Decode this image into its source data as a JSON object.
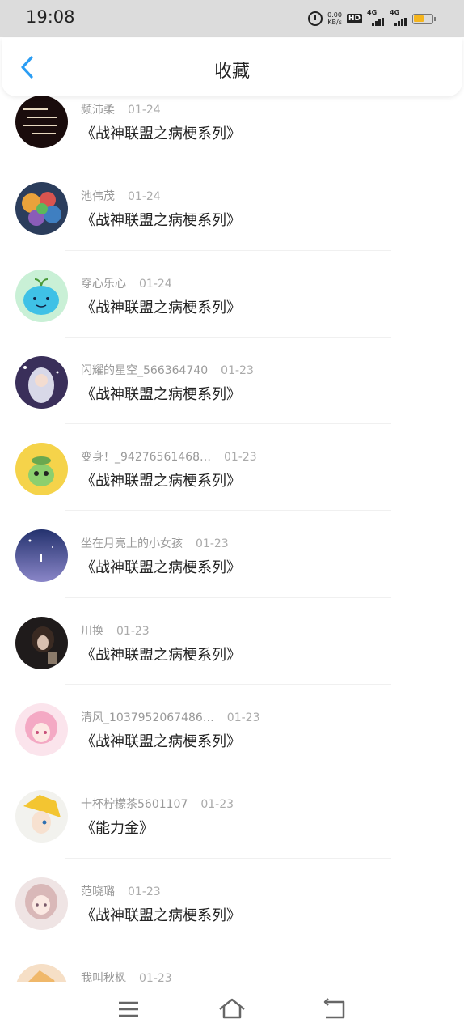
{
  "status_bar": {
    "time": "19:08",
    "net_speed_value": "0.00",
    "net_speed_unit": "KB/s",
    "hd_label": "HD",
    "signal1": "4G",
    "signal2": "4G"
  },
  "header": {
    "title": "收藏",
    "back_icon": "chevron-left-icon"
  },
  "items": [
    {
      "user": "频沛柔",
      "date": "01-24",
      "title": "《战神联盟之病梗系列》"
    },
    {
      "user": "池伟茂",
      "date": "01-24",
      "title": "《战神联盟之病梗系列》"
    },
    {
      "user": "穿心乐心",
      "date": "01-24",
      "title": "《战神联盟之病梗系列》"
    },
    {
      "user": "闪耀的星空_566364740",
      "date": "01-23",
      "title": "《战神联盟之病梗系列》"
    },
    {
      "user": "变身！_94276561468…",
      "date": "01-23",
      "title": "《战神联盟之病梗系列》"
    },
    {
      "user": "坐在月亮上的小女孩",
      "date": "01-23",
      "title": "《战神联盟之病梗系列》"
    },
    {
      "user": "川换",
      "date": "01-23",
      "title": "《战神联盟之病梗系列》"
    },
    {
      "user": "清风_1037952067486…",
      "date": "01-23",
      "title": "《战神联盟之病梗系列》"
    },
    {
      "user": "十杯柠檬茶5601107",
      "date": "01-23",
      "title": "《能力金》"
    },
    {
      "user": "范晓璐",
      "date": "01-23",
      "title": "《战神联盟之病梗系列》"
    },
    {
      "user": "我叫秋枫",
      "date": "01-23",
      "title": ""
    }
  ],
  "bottom_nav": {
    "menu_icon": "menu-icon",
    "home_icon": "home-icon",
    "back_icon": "return-icon"
  },
  "colors": {
    "accent": "#2a9df4",
    "status_bg": "#dcdcdc",
    "battery": "#f5b51d"
  }
}
